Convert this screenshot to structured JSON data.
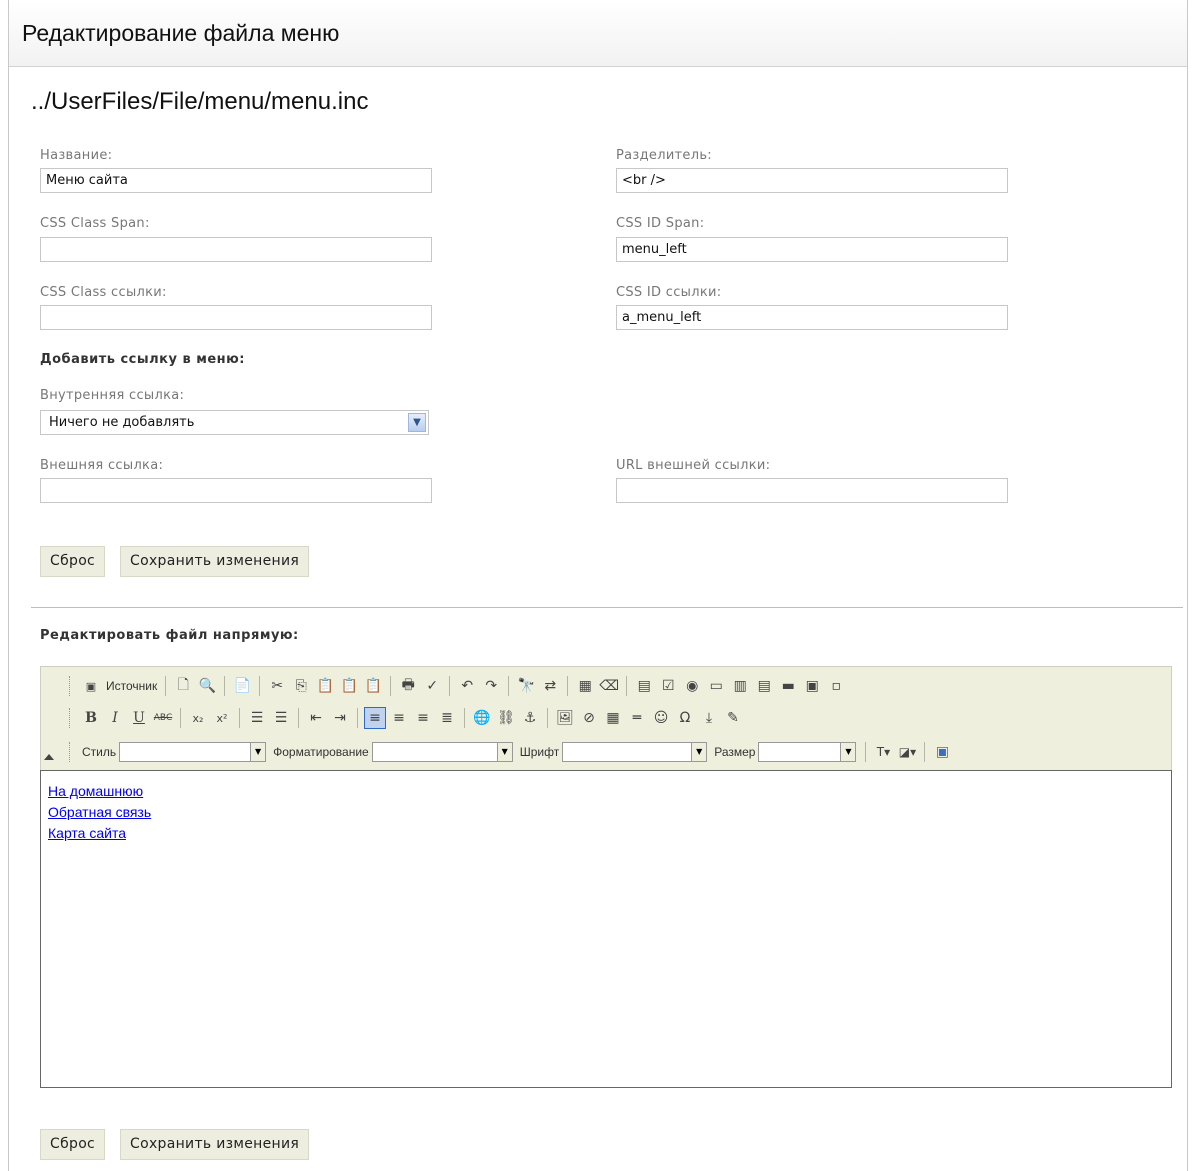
{
  "header": {
    "title": "Редактирование файла меню"
  },
  "file_path": "../UserFiles/File/menu/menu.inc",
  "form": {
    "name": {
      "label": "Название:",
      "value": "Меню сайта"
    },
    "separator": {
      "label": "Разделитель:",
      "value": "<br />"
    },
    "css_class_span": {
      "label": "CSS Class Span:",
      "value": ""
    },
    "css_id_span": {
      "label": "CSS ID Span:",
      "value": "menu_left"
    },
    "css_class_link": {
      "label": "CSS Class ссылки:",
      "value": ""
    },
    "css_id_link": {
      "label": "CSS ID ссылки:",
      "value": "a_menu_left"
    },
    "add_link_heading": "Добавить ссылку в меню:",
    "internal_link": {
      "label": "Внутренняя ссылка:",
      "selected": "Ничего не добавлять"
    },
    "external_link": {
      "label": "Внешняя ссылка:",
      "value": ""
    },
    "external_url": {
      "label": "URL внешней ссылки:",
      "value": ""
    },
    "reset_label": "Сброс",
    "save_label": "Сохранить изменения"
  },
  "direct_edit": {
    "heading": "Редактировать файл напрямую:",
    "toolbar": {
      "source_label": "Источник",
      "style_label": "Стиль",
      "format_label": "Форматирование",
      "font_label": "Шрифт",
      "size_label": "Размер"
    },
    "content_links": [
      "На домашнюю",
      "Обратная связь",
      "Карта сайта"
    ],
    "reset_label": "Сброс",
    "save_label": "Сохранить изменения"
  }
}
